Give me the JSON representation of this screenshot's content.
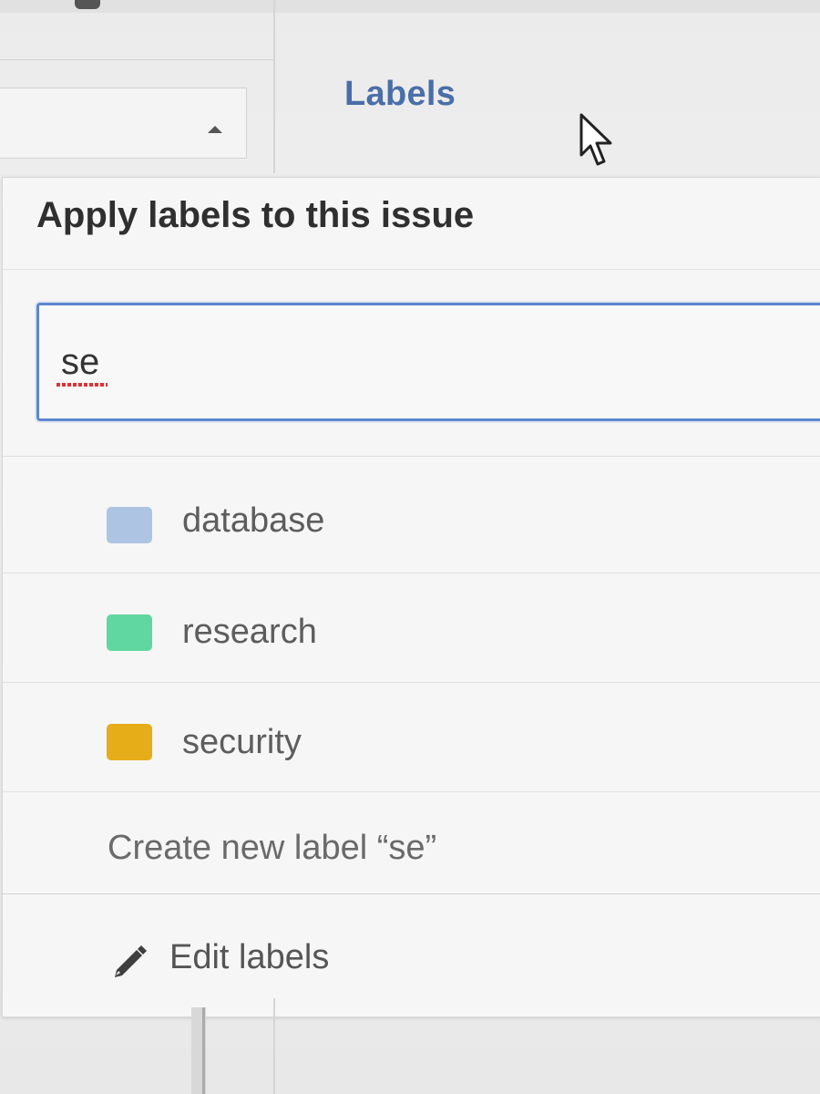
{
  "header": {
    "title": "Labels"
  },
  "dropdown": {
    "title": "Apply labels to this issue",
    "search": {
      "value": "se",
      "placeholder": ""
    },
    "items": [
      {
        "label": "database",
        "color": "#aec4e3"
      },
      {
        "label": "research",
        "color": "#60d7a0"
      },
      {
        "label": "security",
        "color": "#e7ad18"
      }
    ],
    "create_label": "Create new label “se”",
    "edit_labels": "Edit labels"
  }
}
